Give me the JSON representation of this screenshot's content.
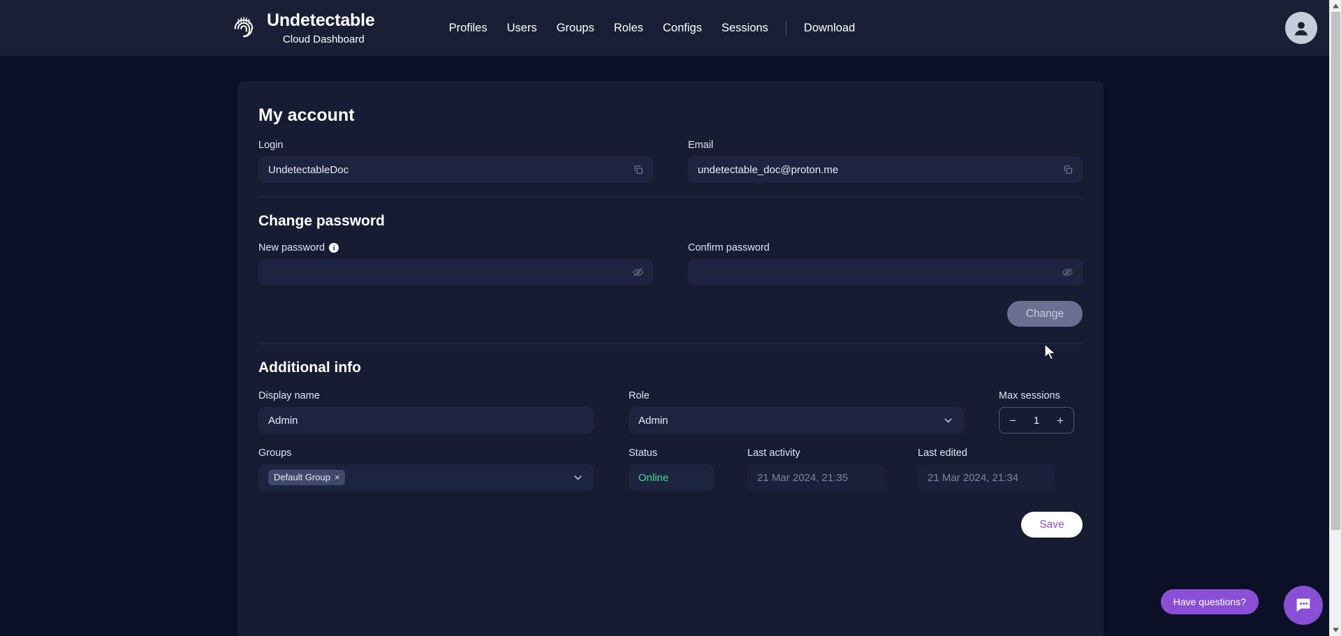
{
  "header": {
    "brand_title": "Undetectable",
    "brand_subtitle": "Cloud Dashboard",
    "logo_icon": "fingerprint-icon",
    "nav": [
      {
        "label": "Profiles"
      },
      {
        "label": "Users"
      },
      {
        "label": "Groups"
      },
      {
        "label": "Roles"
      },
      {
        "label": "Configs"
      },
      {
        "label": "Sessions"
      }
    ],
    "download_label": "Download",
    "avatar_icon": "user-avatar-icon"
  },
  "account": {
    "title": "My account",
    "login_label": "Login",
    "login_value": "UndetectableDoc",
    "login_copy_icon": "copy-icon",
    "email_label": "Email",
    "email_value": "undetectable_doc@proton.me",
    "email_copy_icon": "copy-icon"
  },
  "change_password": {
    "title": "Change password",
    "new_password_label": "New password",
    "new_password_value": "",
    "new_password_info_icon": "info-icon",
    "new_password_toggle_icon": "eye-off-icon",
    "confirm_password_label": "Confirm password",
    "confirm_password_value": "",
    "confirm_password_toggle_icon": "eye-off-icon",
    "change_button": "Change"
  },
  "additional_info": {
    "title": "Additional info",
    "display_name_label": "Display name",
    "display_name_value": "Admin",
    "role_label": "Role",
    "role_value": "Admin",
    "role_chevron_icon": "chevron-down-icon",
    "max_sessions_label": "Max sessions",
    "max_sessions_value": "1",
    "max_sessions_minus": "−",
    "max_sessions_plus": "+",
    "groups_label": "Groups",
    "groups_chip": "Default Group",
    "groups_chip_remove": "×",
    "groups_chevron_icon": "chevron-down-icon",
    "status_label": "Status",
    "status_value": "Online",
    "last_activity_label": "Last activity",
    "last_activity_value": "21 Mar 2024, 21:35",
    "last_edited_label": "Last edited",
    "last_edited_value": "21 Mar 2024, 21:34",
    "save_button": "Save"
  },
  "chat": {
    "pill_label": "Have questions?",
    "button_icon": "chat-bubble-icon"
  },
  "colors": {
    "page_bg": "#0b1026",
    "header_bg": "#1a1f35",
    "card_bg": "#171c32",
    "input_bg": "#1d2440",
    "accent_purple": "#8a4fd6",
    "save_text": "#7d4fe0",
    "status_online": "#3ddc97",
    "disabled_btn": "#6b7093"
  }
}
